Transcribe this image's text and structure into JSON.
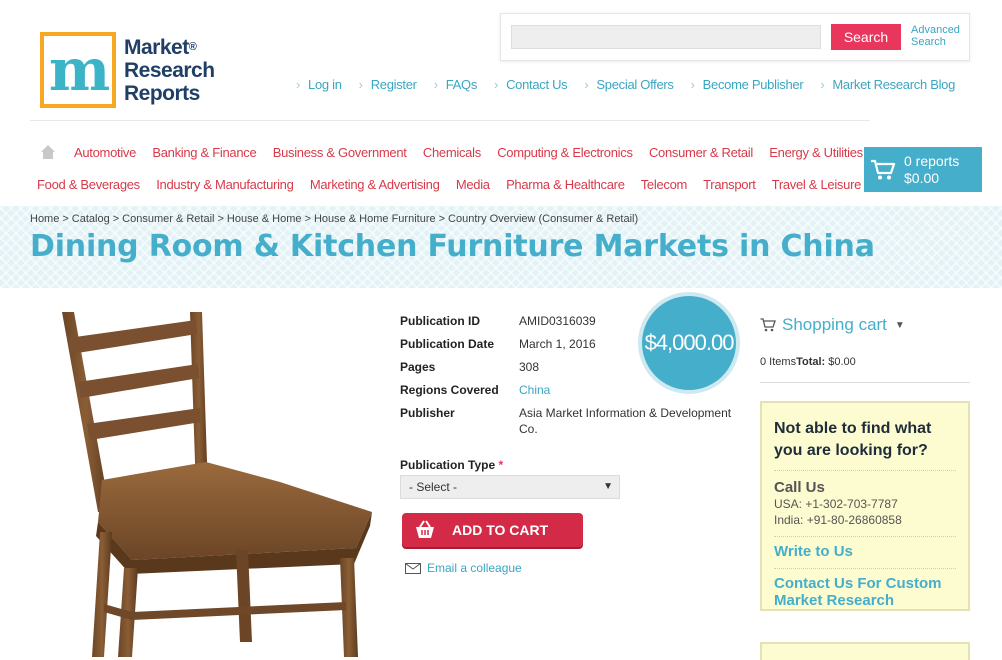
{
  "logo": {
    "line1": "Market",
    "line2": "Research",
    "line3": "Reports",
    "reg": "®"
  },
  "search": {
    "placeholder": "",
    "button": "Search",
    "advanced_line1": "Advanced",
    "advanced_line2": "Search"
  },
  "top_nav": [
    "Log in",
    "Register",
    "FAQs",
    "Contact Us",
    "Special Offers",
    "Become Publisher",
    "Market Research Blog"
  ],
  "categories_row1": [
    "Automotive",
    "Banking & Finance",
    "Business & Government",
    "Chemicals",
    "Computing & Electronics",
    "Consumer & Retail",
    "Energy & Utilities"
  ],
  "categories_row2": [
    "Food & Beverages",
    "Industry & Manufacturing",
    "Marketing & Advertising",
    "Media",
    "Pharma & Healthcare",
    "Telecom",
    "Transport",
    "Travel & Leisure"
  ],
  "cart": {
    "reports": "0 reports",
    "total": "$0.00"
  },
  "breadcrumb": [
    "Home",
    "Catalog",
    "Consumer & Retail",
    "House & Home",
    "House & Home Furniture",
    "Country Overview (Consumer & Retail)"
  ],
  "title": "Dining Room & Kitchen Furniture Markets in China",
  "details": {
    "pub_id_label": "Publication ID",
    "pub_id": "AMID0316039",
    "pub_date_label": "Publication Date",
    "pub_date": "March 1, 2016",
    "pages_label": "Pages",
    "pages": "308",
    "regions_label": "Regions Covered",
    "regions": "China",
    "publisher_label": "Publisher",
    "publisher": "Asia Market Information & Development Co."
  },
  "price": "$4,000.00",
  "pub_type": {
    "label": "Publication Type",
    "required": "*",
    "selected": "- Select -"
  },
  "add_to_cart": "ADD TO CART",
  "email_colleague": "Email a colleague",
  "sidebar": {
    "cart_title": "Shopping cart",
    "items": "0 Items",
    "total_label": "Total:",
    "total_value": "$0.00",
    "help_question": "Not able to find what you are looking for?",
    "call_us": "Call Us",
    "usa_phone": "USA: +1-302-703-7787",
    "india_phone": "India: +91-80-26860858",
    "write_us": "Write to Us",
    "custom_research": "Contact Us For Custom Market Research"
  },
  "colors": {
    "accent": "#45aecb",
    "brand_red": "#d83a4a",
    "cta": "#d32a47",
    "help_bg": "#fdfbd0"
  }
}
